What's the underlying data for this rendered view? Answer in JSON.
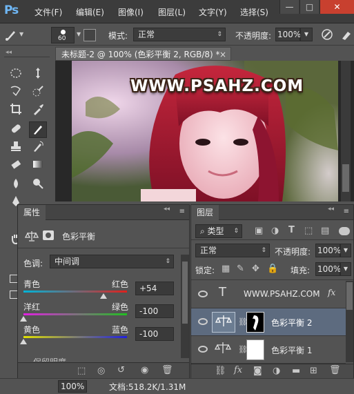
{
  "app": {
    "logo": "Ps"
  },
  "menu": [
    "文件(F)",
    "编辑(E)",
    "图像(I)",
    "图层(L)",
    "文字(Y)",
    "选择(S)"
  ],
  "window_controls": {
    "minimize": "—",
    "maximize": "□",
    "close": "✕"
  },
  "options_bar": {
    "brush_size": "60",
    "mode_label": "模式:",
    "mode_value": "正常",
    "opacity_label": "不透明度:",
    "opacity_value": "100%"
  },
  "document": {
    "tab_title": "未标题-2 @ 100% (色彩平衡 2, RGB/8) *",
    "close_glyph": "×",
    "watermark": "WWW.PSAHZ.COM"
  },
  "properties_panel": {
    "tab": "属性",
    "title": "色彩平衡",
    "tone_label": "色调:",
    "tone_value": "中间调",
    "sliders": [
      {
        "left": "青色",
        "right": "红色",
        "value": "+54",
        "level": 0.77,
        "colors": [
          "#00b4d8",
          "#e0201c"
        ]
      },
      {
        "left": "洋红",
        "right": "绿色",
        "value": "-100",
        "level": 0.0,
        "colors": [
          "#e020e0",
          "#20c020"
        ]
      },
      {
        "left": "黄色",
        "right": "蓝色",
        "value": "-100",
        "level": 0.0,
        "colors": [
          "#e0e000",
          "#2020e0"
        ]
      }
    ],
    "partial_row": "保留明度"
  },
  "layers_panel": {
    "tab": "图层",
    "filter_label": "类型",
    "blend_mode": "正常",
    "opacity_label": "不透明度:",
    "opacity_value": "100%",
    "lock_label": "锁定:",
    "fill_label": "填充:",
    "fill_value": "100%",
    "layers": [
      {
        "name": "WWW.PSAHZ.COM",
        "type": "text",
        "selected": false,
        "fx": "fx"
      },
      {
        "name": "色彩平衡 2",
        "type": "adjustment",
        "selected": true
      },
      {
        "name": "色彩平衡 1",
        "type": "adjustment",
        "selected": false
      }
    ]
  },
  "status": {
    "zoom": "100%",
    "doc_info": "文档:518.2K/1.31M"
  }
}
